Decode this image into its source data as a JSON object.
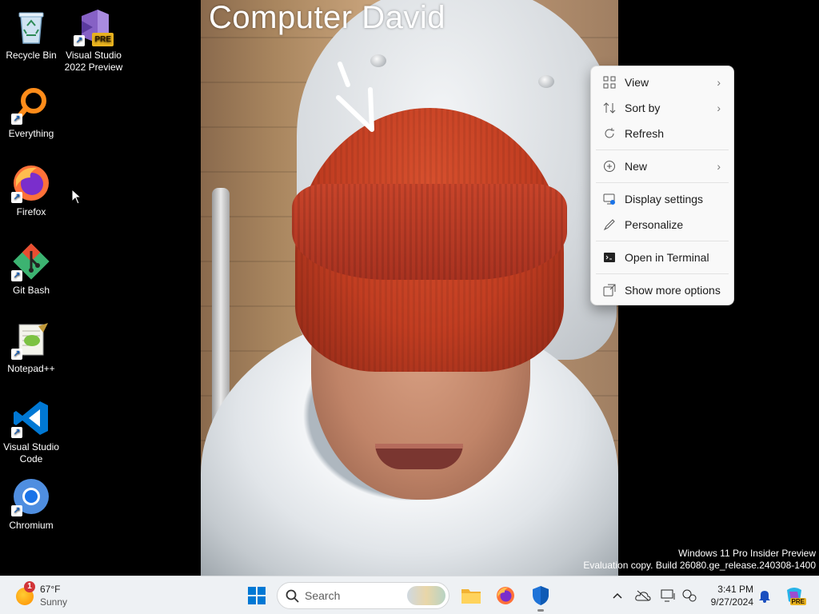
{
  "wallpaper": {
    "caption": "Computer David"
  },
  "desktop_icons": [
    {
      "label": "Recycle Bin",
      "icon": "recycle-bin-icon"
    },
    {
      "label": "Visual Studio 2022 Preview",
      "icon": "visual-studio-preview-icon",
      "badge": "PRE"
    },
    {
      "label": "Everything",
      "icon": "everything-search-icon"
    },
    {
      "label": "Firefox",
      "icon": "firefox-icon"
    },
    {
      "label": "Git Bash",
      "icon": "git-bash-icon"
    },
    {
      "label": "Notepad++",
      "icon": "notepad-plus-plus-icon"
    },
    {
      "label": "Visual Studio Code",
      "icon": "vscode-icon"
    },
    {
      "label": "Chromium",
      "icon": "chromium-icon"
    }
  ],
  "context_menu": {
    "items": [
      {
        "label": "View",
        "icon": "view-grid-icon",
        "submenu": true
      },
      {
        "label": "Sort by",
        "icon": "sort-icon",
        "submenu": true
      },
      {
        "label": "Refresh",
        "icon": "refresh-icon",
        "submenu": false
      },
      {
        "label": "New",
        "icon": "new-plus-icon",
        "submenu": true
      },
      {
        "label": "Display settings",
        "icon": "display-settings-icon",
        "submenu": false
      },
      {
        "label": "Personalize",
        "icon": "personalize-pen-icon",
        "submenu": false
      },
      {
        "label": "Open in Terminal",
        "icon": "terminal-icon",
        "submenu": false
      },
      {
        "label": "Show more options",
        "icon": "show-more-icon",
        "submenu": false
      }
    ]
  },
  "watermark": {
    "line1": "Windows 11 Pro Insider Preview",
    "line2": "Evaluation copy. Build 26080.ge_release.240308-1400"
  },
  "taskbar": {
    "weather": {
      "badge": "1",
      "temperature": "67°F",
      "condition": "Sunny"
    },
    "search_placeholder": "Search",
    "clock": {
      "time": "3:41 PM",
      "date": "9/27/2024"
    },
    "copilot_badge": "PRE"
  },
  "colors": {
    "accent": "#0067c0",
    "taskbar_bg": "#eef1f4",
    "menu_bg": "#f9f9f9"
  }
}
